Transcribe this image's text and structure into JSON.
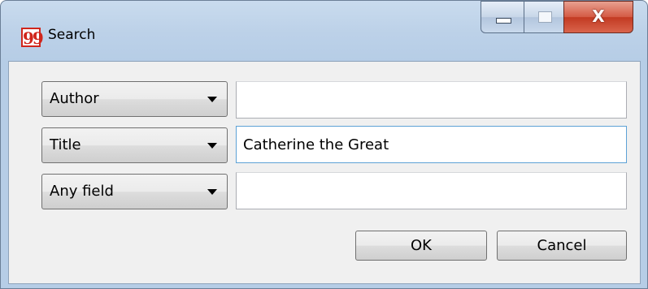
{
  "window": {
    "title": "Search",
    "icon": "quote-icon",
    "icon_glyph": "99",
    "close_glyph": "X"
  },
  "rows": [
    {
      "field_selector": "Author",
      "value": ""
    },
    {
      "field_selector": "Title",
      "value": "Catherine the Great"
    },
    {
      "field_selector": "Any field",
      "value": ""
    }
  ],
  "buttons": {
    "ok": "OK",
    "cancel": "Cancel"
  },
  "colors": {
    "app_icon_red": "#d0261c",
    "close_button_red": "#c23a22",
    "focus_border": "#5da2d6"
  }
}
